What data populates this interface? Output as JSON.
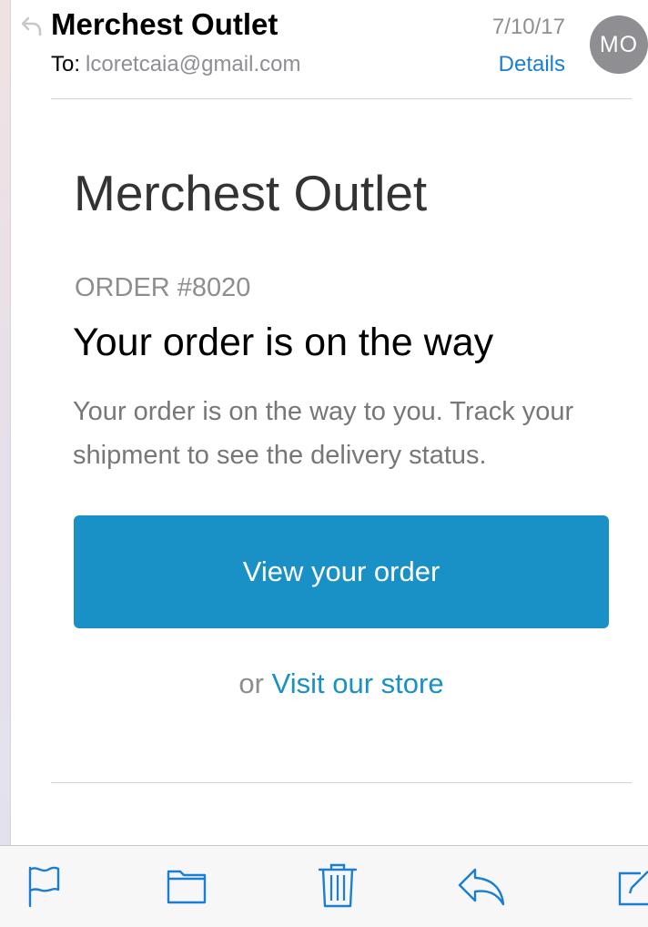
{
  "message": {
    "sender": "Merchest Outlet",
    "to_label": "To:",
    "to_address": "lcoretcaia@gmail.com",
    "date": "7/10/17",
    "details_label": "Details",
    "avatar_initials": "MO"
  },
  "email_body": {
    "shop_name": "Merchest Outlet",
    "order_number": "ORDER #8020",
    "heading": "Your order is on the way",
    "text": "Your order is on the way to you. Track your shipment to see the delivery status.",
    "button_label": "View your order",
    "or_text": "or",
    "store_link": "Visit our store"
  },
  "toolbar": {
    "items": [
      "flag-icon",
      "folder-icon",
      "trash-icon",
      "reply-icon",
      "compose-icon"
    ]
  },
  "colors": {
    "accent": "#1990c6",
    "link_blue": "#1a7fd3",
    "avatar_gray": "#8e8e93"
  }
}
